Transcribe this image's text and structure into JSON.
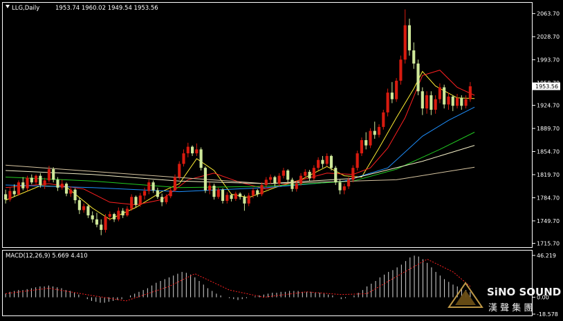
{
  "header": {
    "symbol": "LLG,Daily",
    "ohlc": "1953.74 1960.02 1949.54 1953.56"
  },
  "watermark": {
    "logo_text": "SiNO SOUND",
    "logo_chinese": "漢 聲 集 團"
  },
  "colors": {
    "bull_candle": "#d81b0f",
    "bear_candle": "#cfe89a",
    "ma5": "#ffee33",
    "ma20": "#ff2020",
    "ma60": "#1e90ff",
    "ma120": "#22cc22",
    "ma200": "#f5f0c8",
    "ma400": "#d8c6a2",
    "last_price_box": "#ffffff"
  },
  "chart_data": [
    {
      "type": "candlestick",
      "title": "LLG,Daily",
      "y_ticks": [
        "2063.70",
        "2028.70",
        "1993.70",
        "1958.70",
        "1924.70",
        "1889.70",
        "1854.70",
        "1819.70",
        "1784.70",
        "1749.70",
        "1715.70"
      ],
      "ylim": [
        1712,
        2078
      ],
      "last_price": 1953.56,
      "last_price_label": "1953.56",
      "candles": [
        [
          1790,
          1797,
          1776,
          1782
        ],
        [
          1782,
          1800,
          1779,
          1795
        ],
        [
          1795,
          1805,
          1786,
          1790
        ],
        [
          1790,
          1811,
          1788,
          1808
        ],
        [
          1808,
          1816,
          1796,
          1799
        ],
        [
          1799,
          1818,
          1795,
          1815
        ],
        [
          1815,
          1820,
          1805,
          1808
        ],
        [
          1808,
          1820,
          1804,
          1818
        ],
        [
          1818,
          1822,
          1800,
          1804
        ],
        [
          1804,
          1815,
          1798,
          1811
        ],
        [
          1811,
          1833,
          1808,
          1828
        ],
        [
          1828,
          1831,
          1808,
          1812
        ],
        [
          1812,
          1816,
          1795,
          1800
        ],
        [
          1800,
          1812,
          1797,
          1806
        ],
        [
          1806,
          1808,
          1787,
          1791
        ],
        [
          1791,
          1802,
          1786,
          1797
        ],
        [
          1797,
          1799,
          1776,
          1781
        ],
        [
          1781,
          1785,
          1760,
          1766
        ],
        [
          1766,
          1776,
          1762,
          1772
        ],
        [
          1772,
          1774,
          1754,
          1758
        ],
        [
          1758,
          1764,
          1747,
          1752
        ],
        [
          1752,
          1762,
          1740,
          1744
        ],
        [
          1744,
          1752,
          1728,
          1736
        ],
        [
          1736,
          1760,
          1732,
          1756
        ],
        [
          1756,
          1764,
          1750,
          1760
        ],
        [
          1760,
          1762,
          1748,
          1752
        ],
        [
          1752,
          1770,
          1749,
          1765
        ],
        [
          1765,
          1769,
          1754,
          1758
        ],
        [
          1758,
          1772,
          1756,
          1768
        ],
        [
          1768,
          1790,
          1765,
          1786
        ],
        [
          1786,
          1788,
          1770,
          1774
        ],
        [
          1774,
          1792,
          1771,
          1788
        ],
        [
          1788,
          1800,
          1782,
          1795
        ],
        [
          1795,
          1812,
          1790,
          1808
        ],
        [
          1808,
          1811,
          1792,
          1796
        ],
        [
          1796,
          1800,
          1783,
          1786
        ],
        [
          1786,
          1791,
          1772,
          1778
        ],
        [
          1778,
          1790,
          1775,
          1787
        ],
        [
          1787,
          1800,
          1784,
          1796
        ],
        [
          1796,
          1820,
          1794,
          1816
        ],
        [
          1816,
          1840,
          1812,
          1836
        ],
        [
          1836,
          1858,
          1832,
          1852
        ],
        [
          1852,
          1868,
          1846,
          1862
        ],
        [
          1862,
          1864,
          1848,
          1852
        ],
        [
          1852,
          1867,
          1848,
          1858
        ],
        [
          1858,
          1861,
          1826,
          1830
        ],
        [
          1830,
          1832,
          1792,
          1796
        ],
        [
          1796,
          1808,
          1790,
          1803
        ],
        [
          1803,
          1806,
          1782,
          1786
        ],
        [
          1786,
          1800,
          1783,
          1797
        ],
        [
          1797,
          1799,
          1776,
          1780
        ],
        [
          1780,
          1793,
          1776,
          1789
        ],
        [
          1789,
          1791,
          1779,
          1783
        ],
        [
          1783,
          1794,
          1780,
          1791
        ],
        [
          1791,
          1793,
          1782,
          1786
        ],
        [
          1786,
          1789,
          1765,
          1776
        ],
        [
          1776,
          1792,
          1772,
          1788
        ],
        [
          1788,
          1800,
          1784,
          1796
        ],
        [
          1796,
          1798,
          1786,
          1790
        ],
        [
          1790,
          1808,
          1787,
          1804
        ],
        [
          1804,
          1816,
          1800,
          1812
        ],
        [
          1812,
          1820,
          1806,
          1816
        ],
        [
          1816,
          1818,
          1802,
          1806
        ],
        [
          1806,
          1822,
          1802,
          1818
        ],
        [
          1818,
          1830,
          1814,
          1826
        ],
        [
          1826,
          1828,
          1808,
          1812
        ],
        [
          1812,
          1815,
          1794,
          1798
        ],
        [
          1798,
          1810,
          1794,
          1806
        ],
        [
          1806,
          1822,
          1803,
          1818
        ],
        [
          1818,
          1828,
          1813,
          1824
        ],
        [
          1824,
          1827,
          1810,
          1814
        ],
        [
          1814,
          1834,
          1811,
          1830
        ],
        [
          1830,
          1846,
          1826,
          1842
        ],
        [
          1842,
          1848,
          1830,
          1836
        ],
        [
          1836,
          1852,
          1832,
          1848
        ],
        [
          1848,
          1850,
          1826,
          1830
        ],
        [
          1830,
          1833,
          1804,
          1808
        ],
        [
          1808,
          1812,
          1790,
          1796
        ],
        [
          1796,
          1806,
          1790,
          1802
        ],
        [
          1802,
          1816,
          1798,
          1812
        ],
        [
          1812,
          1834,
          1808,
          1830
        ],
        [
          1830,
          1856,
          1826,
          1852
        ],
        [
          1852,
          1876,
          1848,
          1872
        ],
        [
          1872,
          1884,
          1858,
          1864
        ],
        [
          1864,
          1890,
          1860,
          1886
        ],
        [
          1886,
          1900,
          1874,
          1880
        ],
        [
          1880,
          1896,
          1876,
          1892
        ],
        [
          1892,
          1918,
          1888,
          1914
        ],
        [
          1914,
          1950,
          1908,
          1944
        ],
        [
          1944,
          1960,
          1928,
          1934
        ],
        [
          1934,
          1966,
          1930,
          1962
        ],
        [
          1962,
          2000,
          1956,
          1994
        ],
        [
          1994,
          2070,
          1988,
          2046
        ],
        [
          2046,
          2056,
          2000,
          2008
        ],
        [
          2008,
          2020,
          1980,
          1988
        ],
        [
          1988,
          1994,
          1940,
          1946
        ],
        [
          1946,
          1952,
          1910,
          1920
        ],
        [
          1920,
          1946,
          1912,
          1940
        ],
        [
          1940,
          1946,
          1910,
          1918
        ],
        [
          1918,
          1940,
          1912,
          1934
        ],
        [
          1934,
          1958,
          1928,
          1952
        ],
        [
          1952,
          1956,
          1920,
          1926
        ],
        [
          1926,
          1944,
          1918,
          1938
        ],
        [
          1938,
          1940,
          1916,
          1924
        ],
        [
          1924,
          1942,
          1920,
          1936
        ],
        [
          1936,
          1940,
          1918,
          1924
        ],
        [
          1924,
          1940,
          1920,
          1934
        ],
        [
          1934,
          1960,
          1930,
          1953.56
        ]
      ],
      "moving_averages": [
        {
          "color_key": "ma5",
          "values": [
            [
              0,
              1781
            ],
            [
              8,
              1803
            ],
            [
              14,
              1801
            ],
            [
              20,
              1769
            ],
            [
              24,
              1752
            ],
            [
              30,
              1770
            ],
            [
              36,
              1794
            ],
            [
              40,
              1806
            ],
            [
              44,
              1844
            ],
            [
              48,
              1826
            ],
            [
              52,
              1790
            ],
            [
              56,
              1785
            ],
            [
              62,
              1800
            ],
            [
              68,
              1812
            ],
            [
              74,
              1832
            ],
            [
              78,
              1818
            ],
            [
              82,
              1816
            ],
            [
              86,
              1860
            ],
            [
              90,
              1906
            ],
            [
              94,
              1950
            ],
            [
              96,
              1976
            ],
            [
              99,
              1954
            ],
            [
              104,
              1936
            ],
            [
              108,
              1935
            ]
          ]
        },
        {
          "color_key": "ma20",
          "values": [
            [
              0,
              1800
            ],
            [
              10,
              1806
            ],
            [
              18,
              1798
            ],
            [
              24,
              1778
            ],
            [
              30,
              1774
            ],
            [
              36,
              1782
            ],
            [
              42,
              1812
            ],
            [
              48,
              1822
            ],
            [
              54,
              1808
            ],
            [
              60,
              1798
            ],
            [
              66,
              1808
            ],
            [
              74,
              1822
            ],
            [
              80,
              1820
            ],
            [
              84,
              1830
            ],
            [
              88,
              1860
            ],
            [
              92,
              1906
            ],
            [
              96,
              1970
            ],
            [
              100,
              1978
            ],
            [
              104,
              1952
            ],
            [
              108,
              1940
            ]
          ]
        },
        {
          "color_key": "ma60",
          "values": [
            [
              0,
              1804
            ],
            [
              20,
              1800
            ],
            [
              40,
              1794
            ],
            [
              60,
              1800
            ],
            [
              78,
              1810
            ],
            [
              88,
              1830
            ],
            [
              96,
              1878
            ],
            [
              102,
              1902
            ],
            [
              108,
              1922
            ]
          ]
        },
        {
          "color_key": "ma120",
          "values": [
            [
              0,
              1816
            ],
            [
              20,
              1810
            ],
            [
              40,
              1800
            ],
            [
              60,
              1802
            ],
            [
              80,
              1810
            ],
            [
              90,
              1828
            ],
            [
              100,
              1858
            ],
            [
              108,
              1884
            ]
          ]
        },
        {
          "color_key": "ma200",
          "values": [
            [
              0,
              1826
            ],
            [
              20,
              1820
            ],
            [
              40,
              1810
            ],
            [
              60,
              1806
            ],
            [
              80,
              1814
            ],
            [
              96,
              1840
            ],
            [
              108,
              1864
            ]
          ]
        },
        {
          "color_key": "ma400",
          "values": [
            [
              0,
              1834
            ],
            [
              30,
              1820
            ],
            [
              60,
              1806
            ],
            [
              90,
              1812
            ],
            [
              108,
              1831
            ]
          ]
        }
      ]
    },
    {
      "type": "histogram",
      "title": "MACD(12,26,9) 5.669 4.410",
      "indicator_label": "MACD(12,26,9)",
      "macd_value": 5.669,
      "signal_value": 4.41,
      "y_ticks": [
        "46.219",
        "0.00",
        "-18.578"
      ],
      "ylim": [
        -18.578,
        46.219
      ],
      "bars": [
        4,
        6,
        7,
        8,
        8,
        9,
        10,
        11,
        12,
        12,
        13,
        12,
        11,
        10,
        8,
        7,
        5,
        3,
        0,
        -2,
        -4,
        -5,
        -6,
        -6,
        -5,
        -4,
        -3,
        -2,
        0,
        2,
        4,
        6,
        8,
        10,
        13,
        16,
        18,
        20,
        22,
        24,
        26,
        28,
        27,
        25,
        22,
        18,
        14,
        10,
        7,
        4,
        2,
        0,
        -1,
        -2,
        -3,
        -2,
        -1,
        0,
        1,
        2,
        3,
        4,
        5,
        5,
        6,
        6,
        7,
        7,
        7,
        6,
        6,
        6,
        5,
        5,
        4,
        3,
        2,
        0,
        -2,
        -1,
        0,
        2,
        5,
        8,
        12,
        15,
        18,
        22,
        25,
        28,
        30,
        33,
        36,
        40,
        44,
        46,
        45,
        42,
        38,
        33,
        28,
        24,
        20,
        17,
        14,
        12,
        10,
        8,
        6
      ],
      "signal": [
        [
          0,
          4
        ],
        [
          10,
          10
        ],
        [
          20,
          2
        ],
        [
          28,
          -4
        ],
        [
          38,
          12
        ],
        [
          44,
          26
        ],
        [
          52,
          8
        ],
        [
          60,
          0
        ],
        [
          70,
          6
        ],
        [
          78,
          3
        ],
        [
          84,
          4
        ],
        [
          92,
          26
        ],
        [
          98,
          42
        ],
        [
          104,
          28
        ],
        [
          108,
          12
        ]
      ]
    }
  ]
}
